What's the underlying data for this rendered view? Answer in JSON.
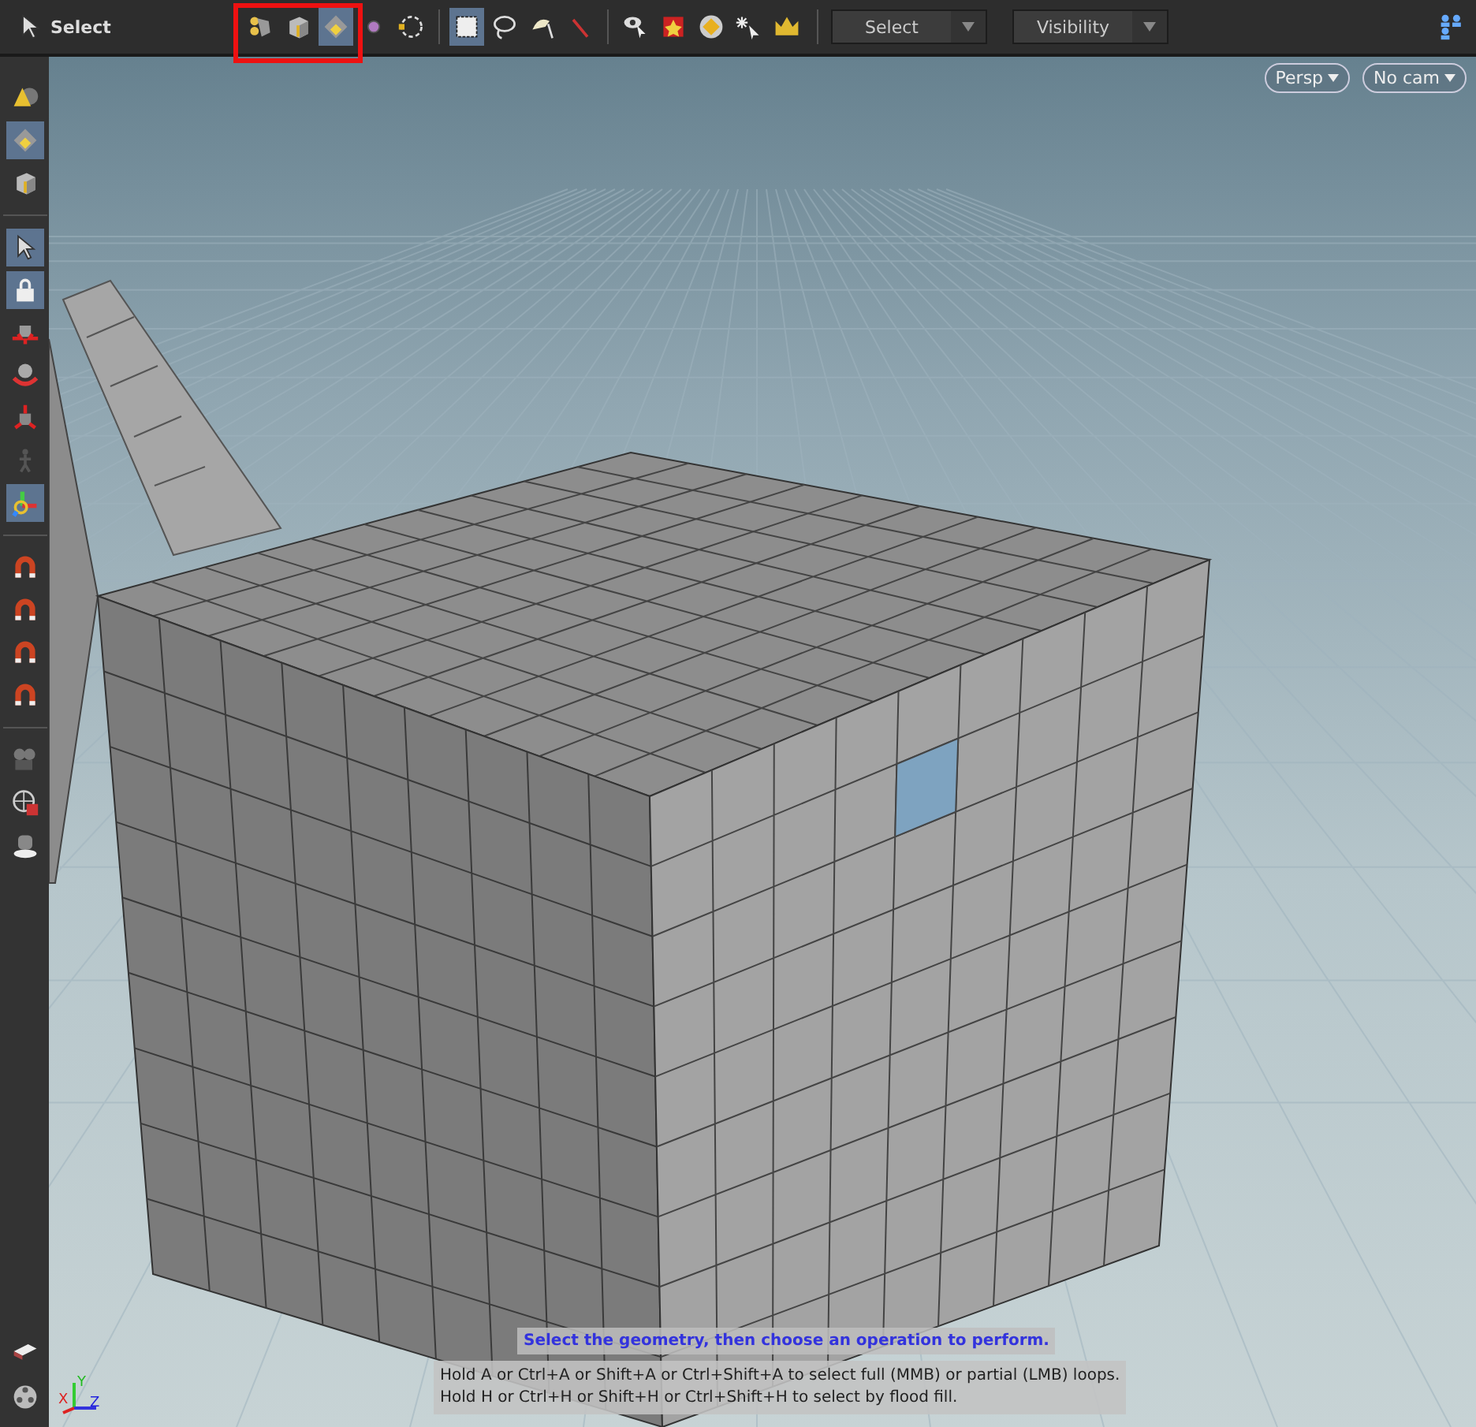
{
  "toolbar": {
    "tool_label": "Select",
    "icons": [
      {
        "kind": "points",
        "selected": false
      },
      {
        "kind": "cube",
        "selected": false
      },
      {
        "kind": "diamond",
        "selected": true
      },
      {
        "kind": "dot",
        "selected": false
      },
      {
        "kind": "ring",
        "selected": false
      },
      {
        "kind": "box",
        "selected": true
      },
      {
        "kind": "lasso",
        "selected": false
      },
      {
        "kind": "brush",
        "selected": false
      },
      {
        "kind": "laser",
        "selected": false
      },
      {
        "kind": "eye",
        "selected": false
      },
      {
        "kind": "star",
        "selected": false
      },
      {
        "kind": "target",
        "selected": false
      },
      {
        "kind": "wand",
        "selected": false
      },
      {
        "kind": "crown",
        "selected": false
      }
    ],
    "dropdowns": [
      "Select",
      "Visibility"
    ]
  },
  "left_toolbar": [
    {
      "kind": "cone",
      "selected": false
    },
    {
      "kind": "diamond",
      "selected": true
    },
    {
      "kind": "cube",
      "selected": false
    },
    {
      "kind": "arrow",
      "selected": true
    },
    {
      "kind": "lock",
      "selected": true
    },
    {
      "kind": "move",
      "selected": false
    },
    {
      "kind": "rotate",
      "selected": false
    },
    {
      "kind": "scale",
      "selected": false
    },
    {
      "kind": "figure",
      "selected": false
    },
    {
      "kind": "handle",
      "selected": true
    },
    {
      "kind": "magnet",
      "selected": false
    },
    {
      "kind": "magnet",
      "selected": false
    },
    {
      "kind": "magnet",
      "selected": false
    },
    {
      "kind": "magnet",
      "selected": false
    },
    {
      "kind": "camera",
      "selected": false
    },
    {
      "kind": "render",
      "selected": false
    },
    {
      "kind": "light",
      "selected": false
    }
  ],
  "left_toolbar_bottom": [
    {
      "kind": "flipbook"
    },
    {
      "kind": "reel"
    }
  ],
  "viewport": {
    "view_buttons": [
      "Persp",
      "No cam"
    ],
    "prompt": "Select the geometry, then choose an operation to perform.",
    "hints": [
      "Hold A or Ctrl+A or Shift+A or Ctrl+Shift+A to select full (MMB) or partial (LMB) loops.",
      "Hold H or Ctrl+H or Shift+H or Ctrl+Shift+H to select by flood fill."
    ],
    "axes": [
      "X",
      "Y",
      "Z"
    ]
  }
}
